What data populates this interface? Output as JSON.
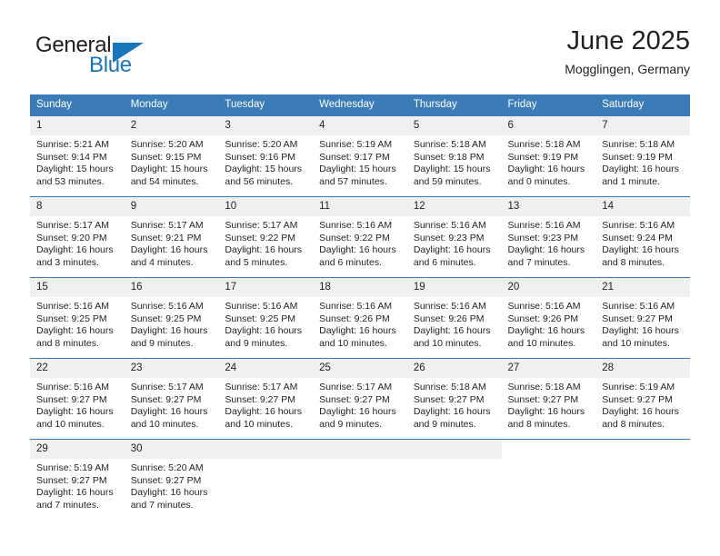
{
  "brand": {
    "name_top": "General",
    "name_bottom": "Blue",
    "triangle_icon": "triangle-icon",
    "color_blue": "#1b75bb",
    "color_dark": "#231f20"
  },
  "header": {
    "title": "June 2025",
    "location": "Mogglingen, Germany"
  },
  "calendar": {
    "accent_color": "#3b7cb8",
    "daynum_bg": "#f0f0f0",
    "weekday_headers": [
      "Sunday",
      "Monday",
      "Tuesday",
      "Wednesday",
      "Thursday",
      "Friday",
      "Saturday"
    ],
    "weeks": [
      [
        {
          "day": "1",
          "sunrise": "Sunrise: 5:21 AM",
          "sunset": "Sunset: 9:14 PM",
          "daylight_1": "Daylight: 15 hours",
          "daylight_2": "and 53 minutes."
        },
        {
          "day": "2",
          "sunrise": "Sunrise: 5:20 AM",
          "sunset": "Sunset: 9:15 PM",
          "daylight_1": "Daylight: 15 hours",
          "daylight_2": "and 54 minutes."
        },
        {
          "day": "3",
          "sunrise": "Sunrise: 5:20 AM",
          "sunset": "Sunset: 9:16 PM",
          "daylight_1": "Daylight: 15 hours",
          "daylight_2": "and 56 minutes."
        },
        {
          "day": "4",
          "sunrise": "Sunrise: 5:19 AM",
          "sunset": "Sunset: 9:17 PM",
          "daylight_1": "Daylight: 15 hours",
          "daylight_2": "and 57 minutes."
        },
        {
          "day": "5",
          "sunrise": "Sunrise: 5:18 AM",
          "sunset": "Sunset: 9:18 PM",
          "daylight_1": "Daylight: 15 hours",
          "daylight_2": "and 59 minutes."
        },
        {
          "day": "6",
          "sunrise": "Sunrise: 5:18 AM",
          "sunset": "Sunset: 9:19 PM",
          "daylight_1": "Daylight: 16 hours",
          "daylight_2": "and 0 minutes."
        },
        {
          "day": "7",
          "sunrise": "Sunrise: 5:18 AM",
          "sunset": "Sunset: 9:19 PM",
          "daylight_1": "Daylight: 16 hours",
          "daylight_2": "and 1 minute."
        }
      ],
      [
        {
          "day": "8",
          "sunrise": "Sunrise: 5:17 AM",
          "sunset": "Sunset: 9:20 PM",
          "daylight_1": "Daylight: 16 hours",
          "daylight_2": "and 3 minutes."
        },
        {
          "day": "9",
          "sunrise": "Sunrise: 5:17 AM",
          "sunset": "Sunset: 9:21 PM",
          "daylight_1": "Daylight: 16 hours",
          "daylight_2": "and 4 minutes."
        },
        {
          "day": "10",
          "sunrise": "Sunrise: 5:17 AM",
          "sunset": "Sunset: 9:22 PM",
          "daylight_1": "Daylight: 16 hours",
          "daylight_2": "and 5 minutes."
        },
        {
          "day": "11",
          "sunrise": "Sunrise: 5:16 AM",
          "sunset": "Sunset: 9:22 PM",
          "daylight_1": "Daylight: 16 hours",
          "daylight_2": "and 6 minutes."
        },
        {
          "day": "12",
          "sunrise": "Sunrise: 5:16 AM",
          "sunset": "Sunset: 9:23 PM",
          "daylight_1": "Daylight: 16 hours",
          "daylight_2": "and 6 minutes."
        },
        {
          "day": "13",
          "sunrise": "Sunrise: 5:16 AM",
          "sunset": "Sunset: 9:23 PM",
          "daylight_1": "Daylight: 16 hours",
          "daylight_2": "and 7 minutes."
        },
        {
          "day": "14",
          "sunrise": "Sunrise: 5:16 AM",
          "sunset": "Sunset: 9:24 PM",
          "daylight_1": "Daylight: 16 hours",
          "daylight_2": "and 8 minutes."
        }
      ],
      [
        {
          "day": "15",
          "sunrise": "Sunrise: 5:16 AM",
          "sunset": "Sunset: 9:25 PM",
          "daylight_1": "Daylight: 16 hours",
          "daylight_2": "and 8 minutes."
        },
        {
          "day": "16",
          "sunrise": "Sunrise: 5:16 AM",
          "sunset": "Sunset: 9:25 PM",
          "daylight_1": "Daylight: 16 hours",
          "daylight_2": "and 9 minutes."
        },
        {
          "day": "17",
          "sunrise": "Sunrise: 5:16 AM",
          "sunset": "Sunset: 9:25 PM",
          "daylight_1": "Daylight: 16 hours",
          "daylight_2": "and 9 minutes."
        },
        {
          "day": "18",
          "sunrise": "Sunrise: 5:16 AM",
          "sunset": "Sunset: 9:26 PM",
          "daylight_1": "Daylight: 16 hours",
          "daylight_2": "and 10 minutes."
        },
        {
          "day": "19",
          "sunrise": "Sunrise: 5:16 AM",
          "sunset": "Sunset: 9:26 PM",
          "daylight_1": "Daylight: 16 hours",
          "daylight_2": "and 10 minutes."
        },
        {
          "day": "20",
          "sunrise": "Sunrise: 5:16 AM",
          "sunset": "Sunset: 9:26 PM",
          "daylight_1": "Daylight: 16 hours",
          "daylight_2": "and 10 minutes."
        },
        {
          "day": "21",
          "sunrise": "Sunrise: 5:16 AM",
          "sunset": "Sunset: 9:27 PM",
          "daylight_1": "Daylight: 16 hours",
          "daylight_2": "and 10 minutes."
        }
      ],
      [
        {
          "day": "22",
          "sunrise": "Sunrise: 5:16 AM",
          "sunset": "Sunset: 9:27 PM",
          "daylight_1": "Daylight: 16 hours",
          "daylight_2": "and 10 minutes."
        },
        {
          "day": "23",
          "sunrise": "Sunrise: 5:17 AM",
          "sunset": "Sunset: 9:27 PM",
          "daylight_1": "Daylight: 16 hours",
          "daylight_2": "and 10 minutes."
        },
        {
          "day": "24",
          "sunrise": "Sunrise: 5:17 AM",
          "sunset": "Sunset: 9:27 PM",
          "daylight_1": "Daylight: 16 hours",
          "daylight_2": "and 10 minutes."
        },
        {
          "day": "25",
          "sunrise": "Sunrise: 5:17 AM",
          "sunset": "Sunset: 9:27 PM",
          "daylight_1": "Daylight: 16 hours",
          "daylight_2": "and 9 minutes."
        },
        {
          "day": "26",
          "sunrise": "Sunrise: 5:18 AM",
          "sunset": "Sunset: 9:27 PM",
          "daylight_1": "Daylight: 16 hours",
          "daylight_2": "and 9 minutes."
        },
        {
          "day": "27",
          "sunrise": "Sunrise: 5:18 AM",
          "sunset": "Sunset: 9:27 PM",
          "daylight_1": "Daylight: 16 hours",
          "daylight_2": "and 8 minutes."
        },
        {
          "day": "28",
          "sunrise": "Sunrise: 5:19 AM",
          "sunset": "Sunset: 9:27 PM",
          "daylight_1": "Daylight: 16 hours",
          "daylight_2": "and 8 minutes."
        }
      ],
      [
        {
          "day": "29",
          "sunrise": "Sunrise: 5:19 AM",
          "sunset": "Sunset: 9:27 PM",
          "daylight_1": "Daylight: 16 hours",
          "daylight_2": "and 7 minutes."
        },
        {
          "day": "30",
          "sunrise": "Sunrise: 5:20 AM",
          "sunset": "Sunset: 9:27 PM",
          "daylight_1": "Daylight: 16 hours",
          "daylight_2": "and 7 minutes."
        },
        {
          "day": "",
          "sunrise": "",
          "sunset": "",
          "daylight_1": "",
          "daylight_2": ""
        },
        {
          "day": "",
          "sunrise": "",
          "sunset": "",
          "daylight_1": "",
          "daylight_2": ""
        },
        {
          "day": "",
          "sunrise": "",
          "sunset": "",
          "daylight_1": "",
          "daylight_2": ""
        },
        {
          "day": "",
          "sunrise": "",
          "sunset": "",
          "daylight_1": "",
          "daylight_2": ""
        },
        {
          "day": "",
          "sunrise": "",
          "sunset": "",
          "daylight_1": "",
          "daylight_2": ""
        }
      ]
    ]
  }
}
